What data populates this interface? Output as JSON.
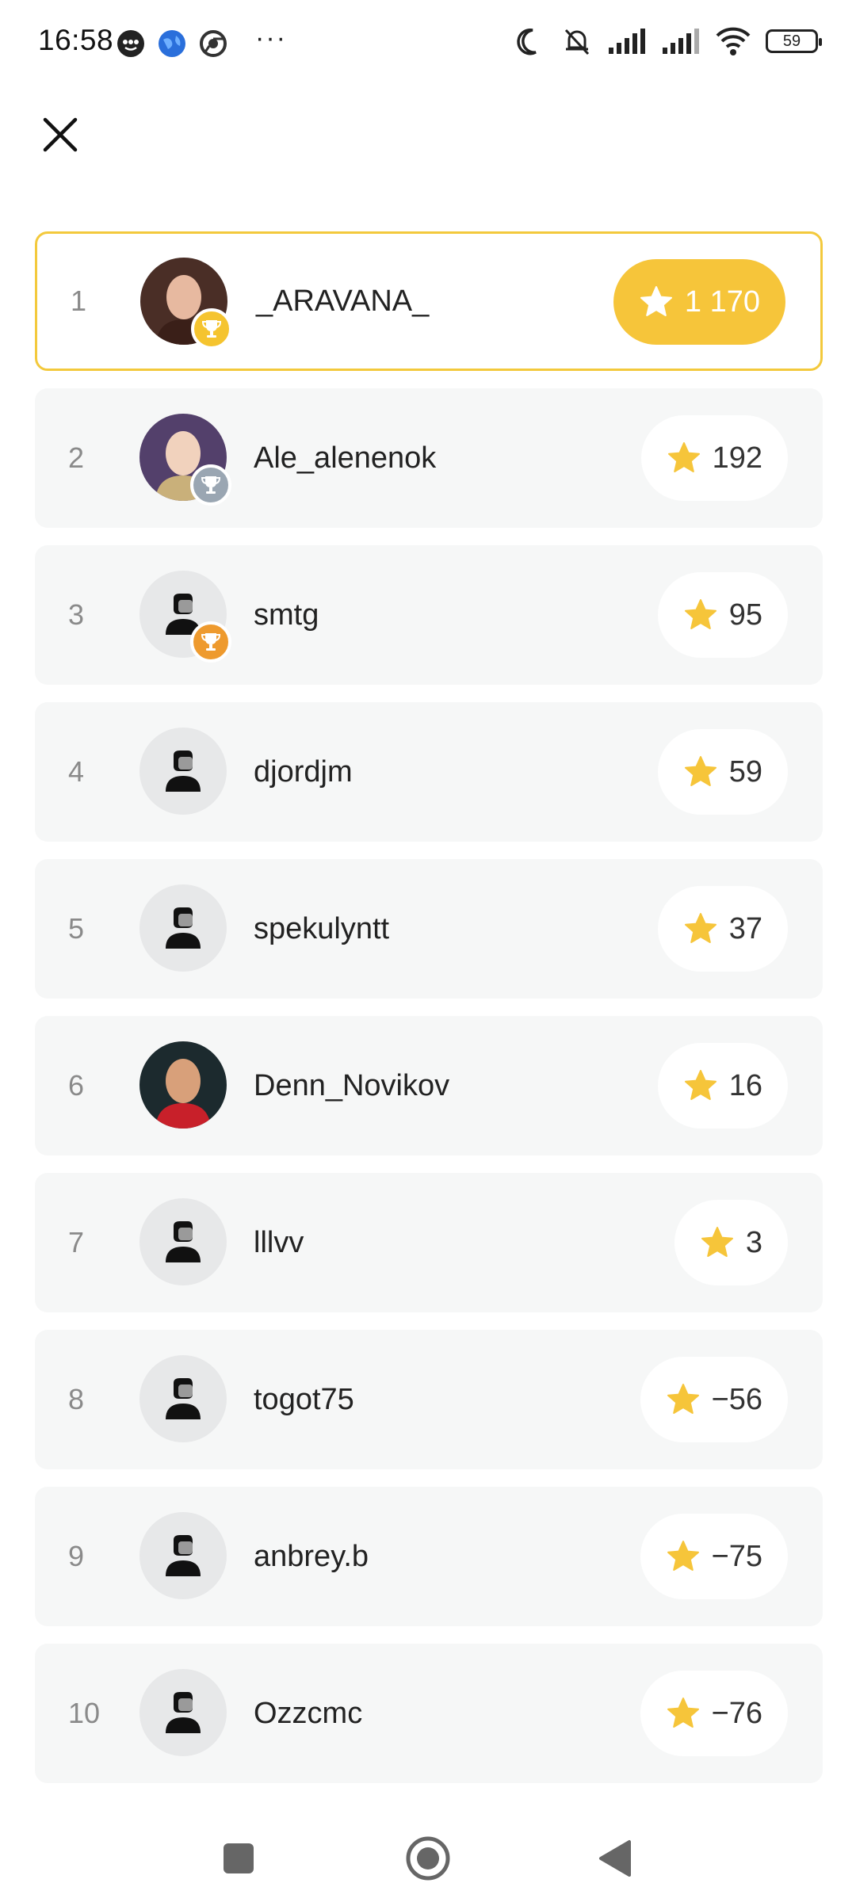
{
  "status_bar": {
    "time": "16:58",
    "battery": "59",
    "icons": [
      "chat-bubble-icon",
      "globe-icon",
      "chrome-icon",
      "more-dots-icon",
      "moon-icon",
      "bell-off-icon",
      "signal-icon",
      "signal-icon",
      "wifi-icon",
      "battery-icon"
    ],
    "dots": "···"
  },
  "header": {
    "close_icon": "close-icon"
  },
  "colors": {
    "accent": "#f6c53a",
    "row_bg": "#f6f7f7",
    "first_border": "#f3c93c",
    "gold": "#f5c42f",
    "silver": "#9aa6b2",
    "bronze": "#ee9a2e"
  },
  "leaderboard": [
    {
      "rank": "1",
      "name": "_ARAVANA_",
      "score": "1 170",
      "medal": "gold",
      "avatar": "photo"
    },
    {
      "rank": "2",
      "name": "Ale_alenenok",
      "score": "192",
      "medal": "silver",
      "avatar": "photo"
    },
    {
      "rank": "3",
      "name": "smtg",
      "score": "95",
      "medal": "bronze",
      "avatar": "default"
    },
    {
      "rank": "4",
      "name": "djordjm",
      "score": "59",
      "medal": "",
      "avatar": "default"
    },
    {
      "rank": "5",
      "name": "spekulyntt",
      "score": "37",
      "medal": "",
      "avatar": "default"
    },
    {
      "rank": "6",
      "name": "Denn_Novikov",
      "score": "16",
      "medal": "",
      "avatar": "photo"
    },
    {
      "rank": "7",
      "name": "lllvv",
      "score": "3",
      "medal": "",
      "avatar": "default"
    },
    {
      "rank": "8",
      "name": "togot75",
      "score": "−56",
      "medal": "",
      "avatar": "default"
    },
    {
      "rank": "9",
      "name": "anbrey.b",
      "score": "−75",
      "medal": "",
      "avatar": "default"
    },
    {
      "rank": "10",
      "name": "Ozzcmc",
      "score": "−76",
      "medal": "",
      "avatar": "default"
    }
  ],
  "nav": {
    "recents_icon": "square-icon",
    "home_icon": "circle-home-icon",
    "back_icon": "back-triangle-icon"
  }
}
